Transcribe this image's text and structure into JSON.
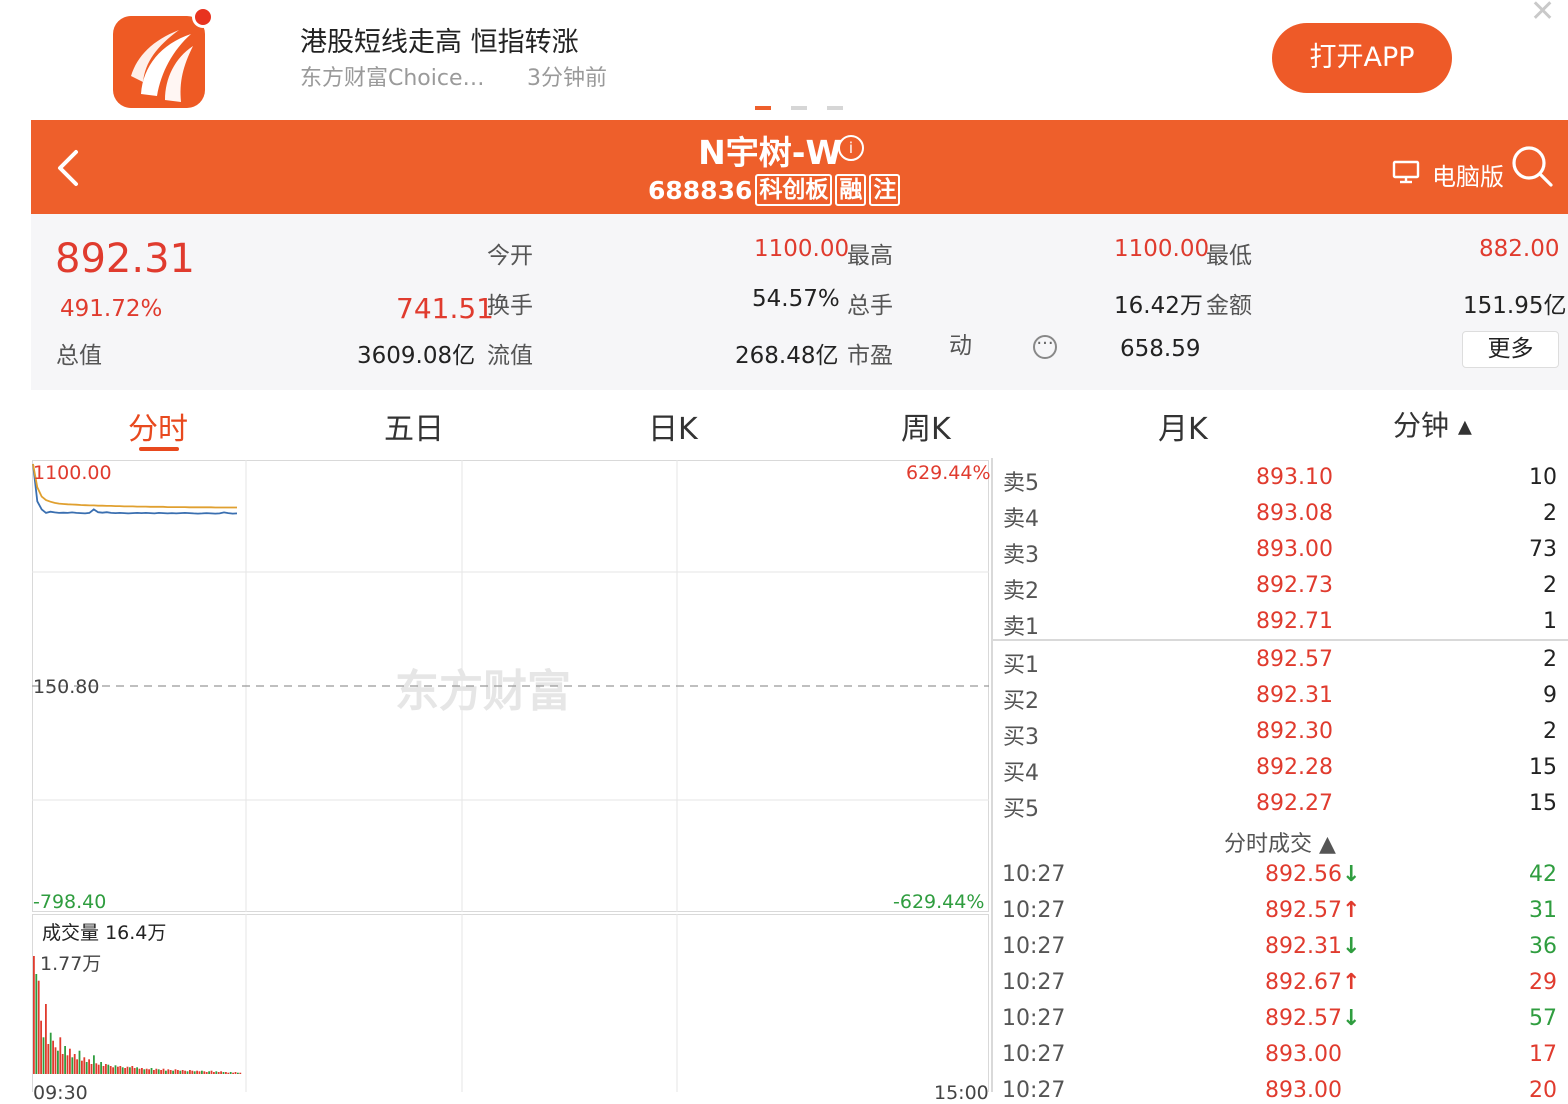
{
  "banner": {
    "headline": "港股短线走高 恒指转涨",
    "source": "东方财富Choice…",
    "time_ago": "3分钟前",
    "open_app_label": "打开APP",
    "close_icon": "close-icon"
  },
  "header": {
    "stock_name": "N宇树-W",
    "stock_code": "688836",
    "tags": [
      "科创板",
      "融",
      "注"
    ],
    "pc_label": "电脑版",
    "colors": {
      "bg": "#ee5f2b"
    }
  },
  "quote": {
    "price": "892.31",
    "change_pct": "491.72%",
    "change_abs": "741.51",
    "total_value_label": "总值",
    "total_value": "3609.08亿",
    "open_label": "今开",
    "open": "1100.00",
    "high_label": "最高",
    "high": "1100.00",
    "low_label": "最低",
    "low": "882.00",
    "turnover_label": "换手",
    "turnover": "54.57%",
    "total_hands_label": "总手",
    "total_hands": "16.42万",
    "amount_label": "金额",
    "amount": "151.95亿",
    "float_value_label": "流值",
    "float_value": "268.48亿",
    "pe_label": "市盈",
    "pe_suffix": "动",
    "pe": "658.59",
    "more_label": "更多"
  },
  "tabs": [
    "分时",
    "五日",
    "日K",
    "周K",
    "月K",
    "分钟 ▴"
  ],
  "chart": {
    "price_top": "1100.00",
    "price_mid": "150.80",
    "price_bottom": "-798.40",
    "pct_top": "629.44%",
    "pct_bottom": "-629.44%",
    "watermark": "东方财富",
    "volume_label": "成交量",
    "volume_value": "16.4万",
    "volume_max": "1.77万",
    "time_start": "09:30",
    "time_end": "15:00"
  },
  "chart_data": {
    "type": "line",
    "ylim": [
      -798.4,
      1100.0
    ],
    "series": [
      {
        "values": [
          1100.0,
          940.0,
          905.0,
          890.0,
          895.0,
          892.0,
          890.0,
          891.0,
          890.0,
          892.0,
          890.0,
          889.0,
          888.0,
          890.0,
          905.0,
          893.0,
          891.0,
          893.0,
          890.0,
          889.0,
          890.0,
          889.0,
          888.0,
          889.0,
          890.0,
          889.0,
          890.0,
          889.0,
          888.0,
          890.0,
          889.0,
          888.0,
          889.0,
          888.0,
          889.0,
          890.0,
          889.0,
          888.0,
          887.0,
          888.0,
          889.0,
          888.0,
          887.0,
          888.0,
          892.0,
          889.0,
          887.0,
          888.0
        ]
      },
      {
        "values": [
          1100.0,
          1000.0,
          960.0,
          945.0,
          938.0,
          933.0,
          930.0,
          928.0,
          927.0,
          926.0,
          925.0,
          924.0,
          923.0,
          922.0,
          922.0,
          921.0,
          921.0,
          920.0,
          920.0,
          919.0,
          919.0,
          918.0,
          918.0,
          918.0,
          917.0,
          917.0,
          917.0,
          916.0,
          916.0,
          916.0,
          916.0,
          915.0,
          915.0,
          915.0,
          915.0,
          915.0,
          914.0,
          914.0,
          914.0,
          914.0,
          914.0,
          914.0,
          913.0,
          913.0,
          913.0,
          913.0,
          913.0,
          913.0
        ]
      }
    ],
    "volume": [
      1.77,
      1.5,
      1.4,
      0.8,
      0.55,
      1.05,
      0.45,
      0.62,
      0.5,
      0.4,
      0.35,
      0.55,
      0.3,
      0.42,
      0.28,
      0.38,
      0.25,
      0.3,
      0.22,
      0.35,
      0.2,
      0.25,
      0.18,
      0.22,
      0.15,
      0.28,
      0.16,
      0.14,
      0.18,
      0.12,
      0.15,
      0.14,
      0.12,
      0.1,
      0.13,
      0.11,
      0.12,
      0.1,
      0.09,
      0.11,
      0.1,
      0.12,
      0.09,
      0.1,
      0.08,
      0.09,
      0.07,
      0.08,
      0.07,
      0.09,
      0.06,
      0.08,
      0.07,
      0.06,
      0.08,
      0.05,
      0.07,
      0.06,
      0.05,
      0.07,
      0.06,
      0.05,
      0.06,
      0.05,
      0.04,
      0.06,
      0.05,
      0.04,
      0.05,
      0.04,
      0.05,
      0.04,
      0.03,
      0.04,
      0.05,
      0.03,
      0.04,
      0.03,
      0.04,
      0.03,
      0.03,
      0.02,
      0.03,
      0.02,
      0.03,
      0.02,
      0.02
    ],
    "volume_colors": {
      "up": "#e03b2e",
      "down": "#2f9d3f"
    }
  },
  "order_book": {
    "asks": [
      {
        "label": "卖5",
        "price": "893.10",
        "vol": "10"
      },
      {
        "label": "卖4",
        "price": "893.08",
        "vol": "2"
      },
      {
        "label": "卖3",
        "price": "893.00",
        "vol": "73"
      },
      {
        "label": "卖2",
        "price": "892.73",
        "vol": "2"
      },
      {
        "label": "卖1",
        "price": "892.71",
        "vol": "1"
      }
    ],
    "bids": [
      {
        "label": "买1",
        "price": "892.57",
        "vol": "2"
      },
      {
        "label": "买2",
        "price": "892.31",
        "vol": "9"
      },
      {
        "label": "买3",
        "price": "892.30",
        "vol": "2"
      },
      {
        "label": "买4",
        "price": "892.28",
        "vol": "15"
      },
      {
        "label": "买5",
        "price": "892.27",
        "vol": "15"
      }
    ],
    "trades_title": "分时成交 ▲",
    "trades": [
      {
        "time": "10:27",
        "price": "892.56",
        "dir": "↓",
        "vol": "42",
        "vol_color": "green"
      },
      {
        "time": "10:27",
        "price": "892.57",
        "dir": "↑",
        "vol": "31",
        "vol_color": "green"
      },
      {
        "time": "10:27",
        "price": "892.31",
        "dir": "↓",
        "vol": "36",
        "vol_color": "green"
      },
      {
        "time": "10:27",
        "price": "892.67",
        "dir": "↑",
        "vol": "29",
        "vol_color": "red"
      },
      {
        "time": "10:27",
        "price": "892.57",
        "dir": "↓",
        "vol": "57",
        "vol_color": "green"
      },
      {
        "time": "10:27",
        "price": "893.00",
        "dir": "",
        "vol": "17",
        "vol_color": "red"
      },
      {
        "time": "10:27",
        "price": "893.00",
        "dir": "",
        "vol": "20",
        "vol_color": "red"
      }
    ]
  }
}
